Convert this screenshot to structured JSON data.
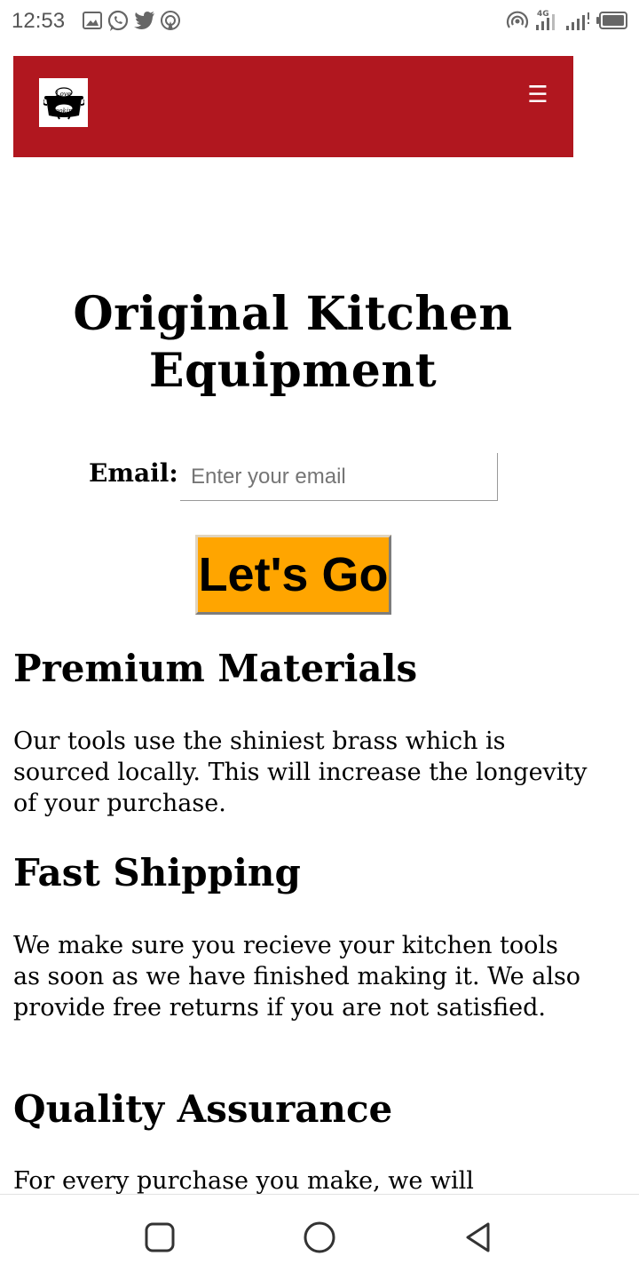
{
  "status_bar": {
    "time": "12:53",
    "left_icons": [
      "image-icon",
      "whatsapp-icon",
      "twitter-icon",
      "hotspot-icon"
    ],
    "right_icons": [
      "hotspot-signal-icon",
      "signal-4g-icon",
      "signal-icon",
      "battery-icon"
    ],
    "network_label": "4G"
  },
  "header": {
    "logo_alt": "Love Cooking",
    "logo_text_top": "Love",
    "logo_text_bottom": "Cooking",
    "menu_icon": "☰",
    "background_color": "#b1171f"
  },
  "hero": {
    "title": "Original Kitchen Equipment",
    "email_label": "Email:",
    "email_placeholder": "Enter your email",
    "email_value": "",
    "submit_label": "Let's Go",
    "submit_color": "#ffa500"
  },
  "sections": [
    {
      "heading": "Premium Materials",
      "text": "Our tools use the shiniest brass which is sourced locally. This will increase the longevity of your purchase."
    },
    {
      "heading": "Fast Shipping",
      "text": "We make sure you recieve your kitchen tools as soon as we have finished making it. We also provide free returns if you are not satisfied."
    },
    {
      "heading": "Quality Assurance",
      "text": "For every purchase you make, we will"
    }
  ],
  "nav_bar": {
    "buttons": [
      "recents-icon",
      "home-icon",
      "back-icon"
    ]
  }
}
